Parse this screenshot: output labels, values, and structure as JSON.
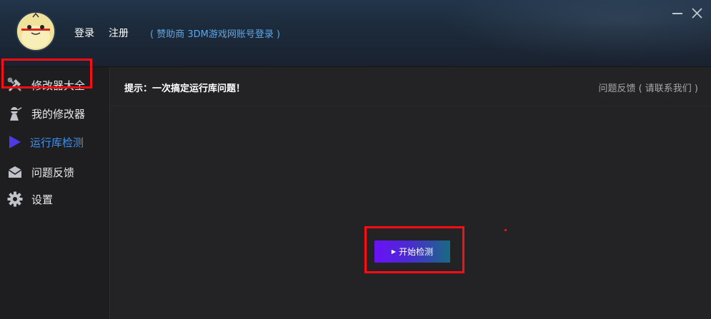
{
  "header": {
    "login_label": "登录",
    "register_label": "注册",
    "sponsor_text": "( 赞助商 3DM游戏网账号登录 )",
    "minimize_icon": "minimize-icon",
    "close_icon": "close-icon"
  },
  "sidebar": {
    "items": [
      {
        "label": "修改器大全",
        "icon": "tools-icon"
      },
      {
        "label": "我的修改器",
        "icon": "ninja-icon"
      },
      {
        "label": "运行库检测",
        "icon": "play-icon",
        "active": true
      },
      {
        "label": "问题反馈",
        "icon": "mail-icon"
      },
      {
        "label": "设置",
        "icon": "gear-icon"
      }
    ]
  },
  "main": {
    "tip": "提示：一次搞定运行库问题！",
    "feedback_link": "问题反馈 ( 请联系我们 )",
    "start_button_label": "开始检测"
  },
  "colors": {
    "accent": "#3f93f0",
    "highlight": "#ff0d12",
    "button_start": "#6a12f6",
    "button_end": "#176b82"
  }
}
